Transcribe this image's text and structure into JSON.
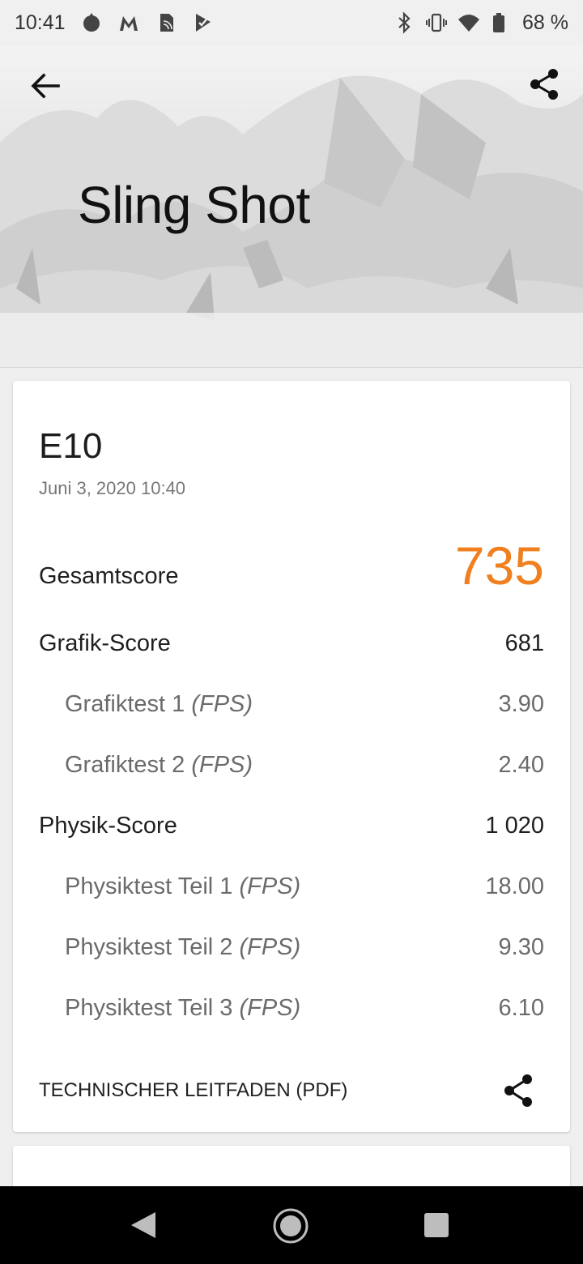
{
  "status_bar": {
    "time": "10:41",
    "battery": "68 %"
  },
  "header": {
    "title": "Sling Shot"
  },
  "result": {
    "device": "E10",
    "date": "Juni 3, 2020 10:40",
    "total_label": "Gesamtscore",
    "total_value": "735",
    "rows": [
      {
        "label": "Grafik-Score",
        "unit": "",
        "value": "681",
        "sub": false
      },
      {
        "label": "Grafiktest 1",
        "unit": "(FPS)",
        "value": "3.90",
        "sub": true
      },
      {
        "label": "Grafiktest 2",
        "unit": "(FPS)",
        "value": "2.40",
        "sub": true
      },
      {
        "label": "Physik-Score",
        "unit": "",
        "value": "1 020",
        "sub": false
      },
      {
        "label": "Physiktest Teil 1",
        "unit": "(FPS)",
        "value": "18.00",
        "sub": true
      },
      {
        "label": "Physiktest Teil 2",
        "unit": "(FPS)",
        "value": "9.30",
        "sub": true
      },
      {
        "label": "Physiktest Teil 3",
        "unit": "(FPS)",
        "value": "6.10",
        "sub": true
      }
    ],
    "guide_link": "TECHNISCHER LEITFADEN (PDF)"
  },
  "colors": {
    "accent": "#f0801f"
  },
  "icons": {
    "back": "arrow-left-icon",
    "share": "share-icon"
  }
}
